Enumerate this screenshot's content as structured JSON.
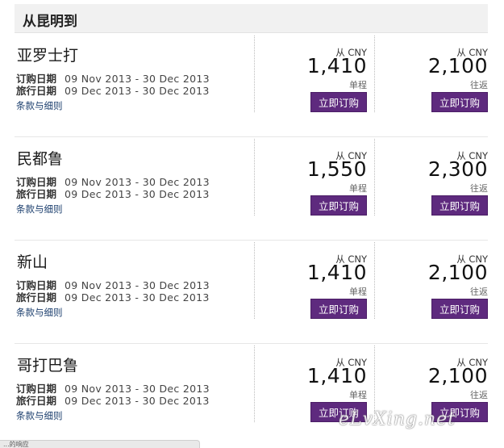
{
  "header": {
    "title": "从昆明到"
  },
  "labels": {
    "purchase": "订购日期",
    "travel": "旅行日期",
    "terms": "条款与细则",
    "from": "从 CNY",
    "one_way": "单程",
    "round_trip": "往返",
    "book": "立即订购"
  },
  "cards": [
    {
      "destination": "亚罗士打",
      "purchase_dates": "09 Nov 2013 - 30 Dec 2013",
      "travel_dates": "09 Dec 2013 - 30 Dec 2013",
      "one_way_price": "1,410",
      "round_trip_price": "2,100"
    },
    {
      "destination": "民都鲁",
      "purchase_dates": "09 Nov 2013 - 30 Dec 2013",
      "travel_dates": "09 Dec 2013 - 30 Dec 2013",
      "one_way_price": "1,550",
      "round_trip_price": "2,300"
    },
    {
      "destination": "新山",
      "purchase_dates": "09 Nov 2013 - 30 Dec 2013",
      "travel_dates": "09 Dec 2013 - 30 Dec 2013",
      "one_way_price": "1,410",
      "round_trip_price": "2,100"
    },
    {
      "destination": "哥打巴鲁",
      "purchase_dates": "09 Nov 2013 - 30 Dec 2013",
      "travel_dates": "09 Dec 2013 - 30 Dec 2013",
      "one_way_price": "1,410",
      "round_trip_price": "2,100"
    }
  ],
  "watermark": "eLvXing.net",
  "status_bar": {
    "text": "...的响应"
  }
}
